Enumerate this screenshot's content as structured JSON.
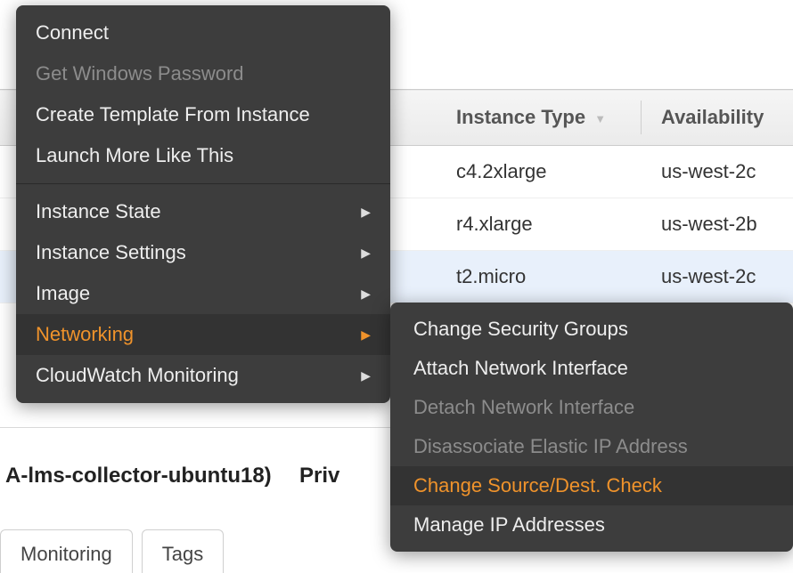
{
  "table": {
    "columns": {
      "instance_type": "Instance Type",
      "availability_zone": "Availability"
    },
    "rows": [
      {
        "type": "c4.2xlarge",
        "az": "us-west-2c"
      },
      {
        "type": "r4.xlarge",
        "az": "us-west-2b"
      },
      {
        "type": "t2.micro",
        "az": "us-west-2c"
      }
    ]
  },
  "detail": {
    "name_fragment": "A-lms-collector-ubuntu18)",
    "priv_label": "Priv"
  },
  "tabs": {
    "monitoring": "Monitoring",
    "tags": "Tags"
  },
  "menu": {
    "connect": "Connect",
    "get_windows_password": "Get Windows Password",
    "create_template": "Create Template From Instance",
    "launch_more": "Launch More Like This",
    "instance_state": "Instance State",
    "instance_settings": "Instance Settings",
    "image": "Image",
    "networking": "Networking",
    "cloudwatch": "CloudWatch Monitoring"
  },
  "submenu": {
    "change_sg": "Change Security Groups",
    "attach_eni": "Attach Network Interface",
    "detach_eni": "Detach Network Interface",
    "disassociate_eip": "Disassociate Elastic IP Address",
    "change_source_dest": "Change Source/Dest. Check",
    "manage_ips": "Manage IP Addresses"
  }
}
